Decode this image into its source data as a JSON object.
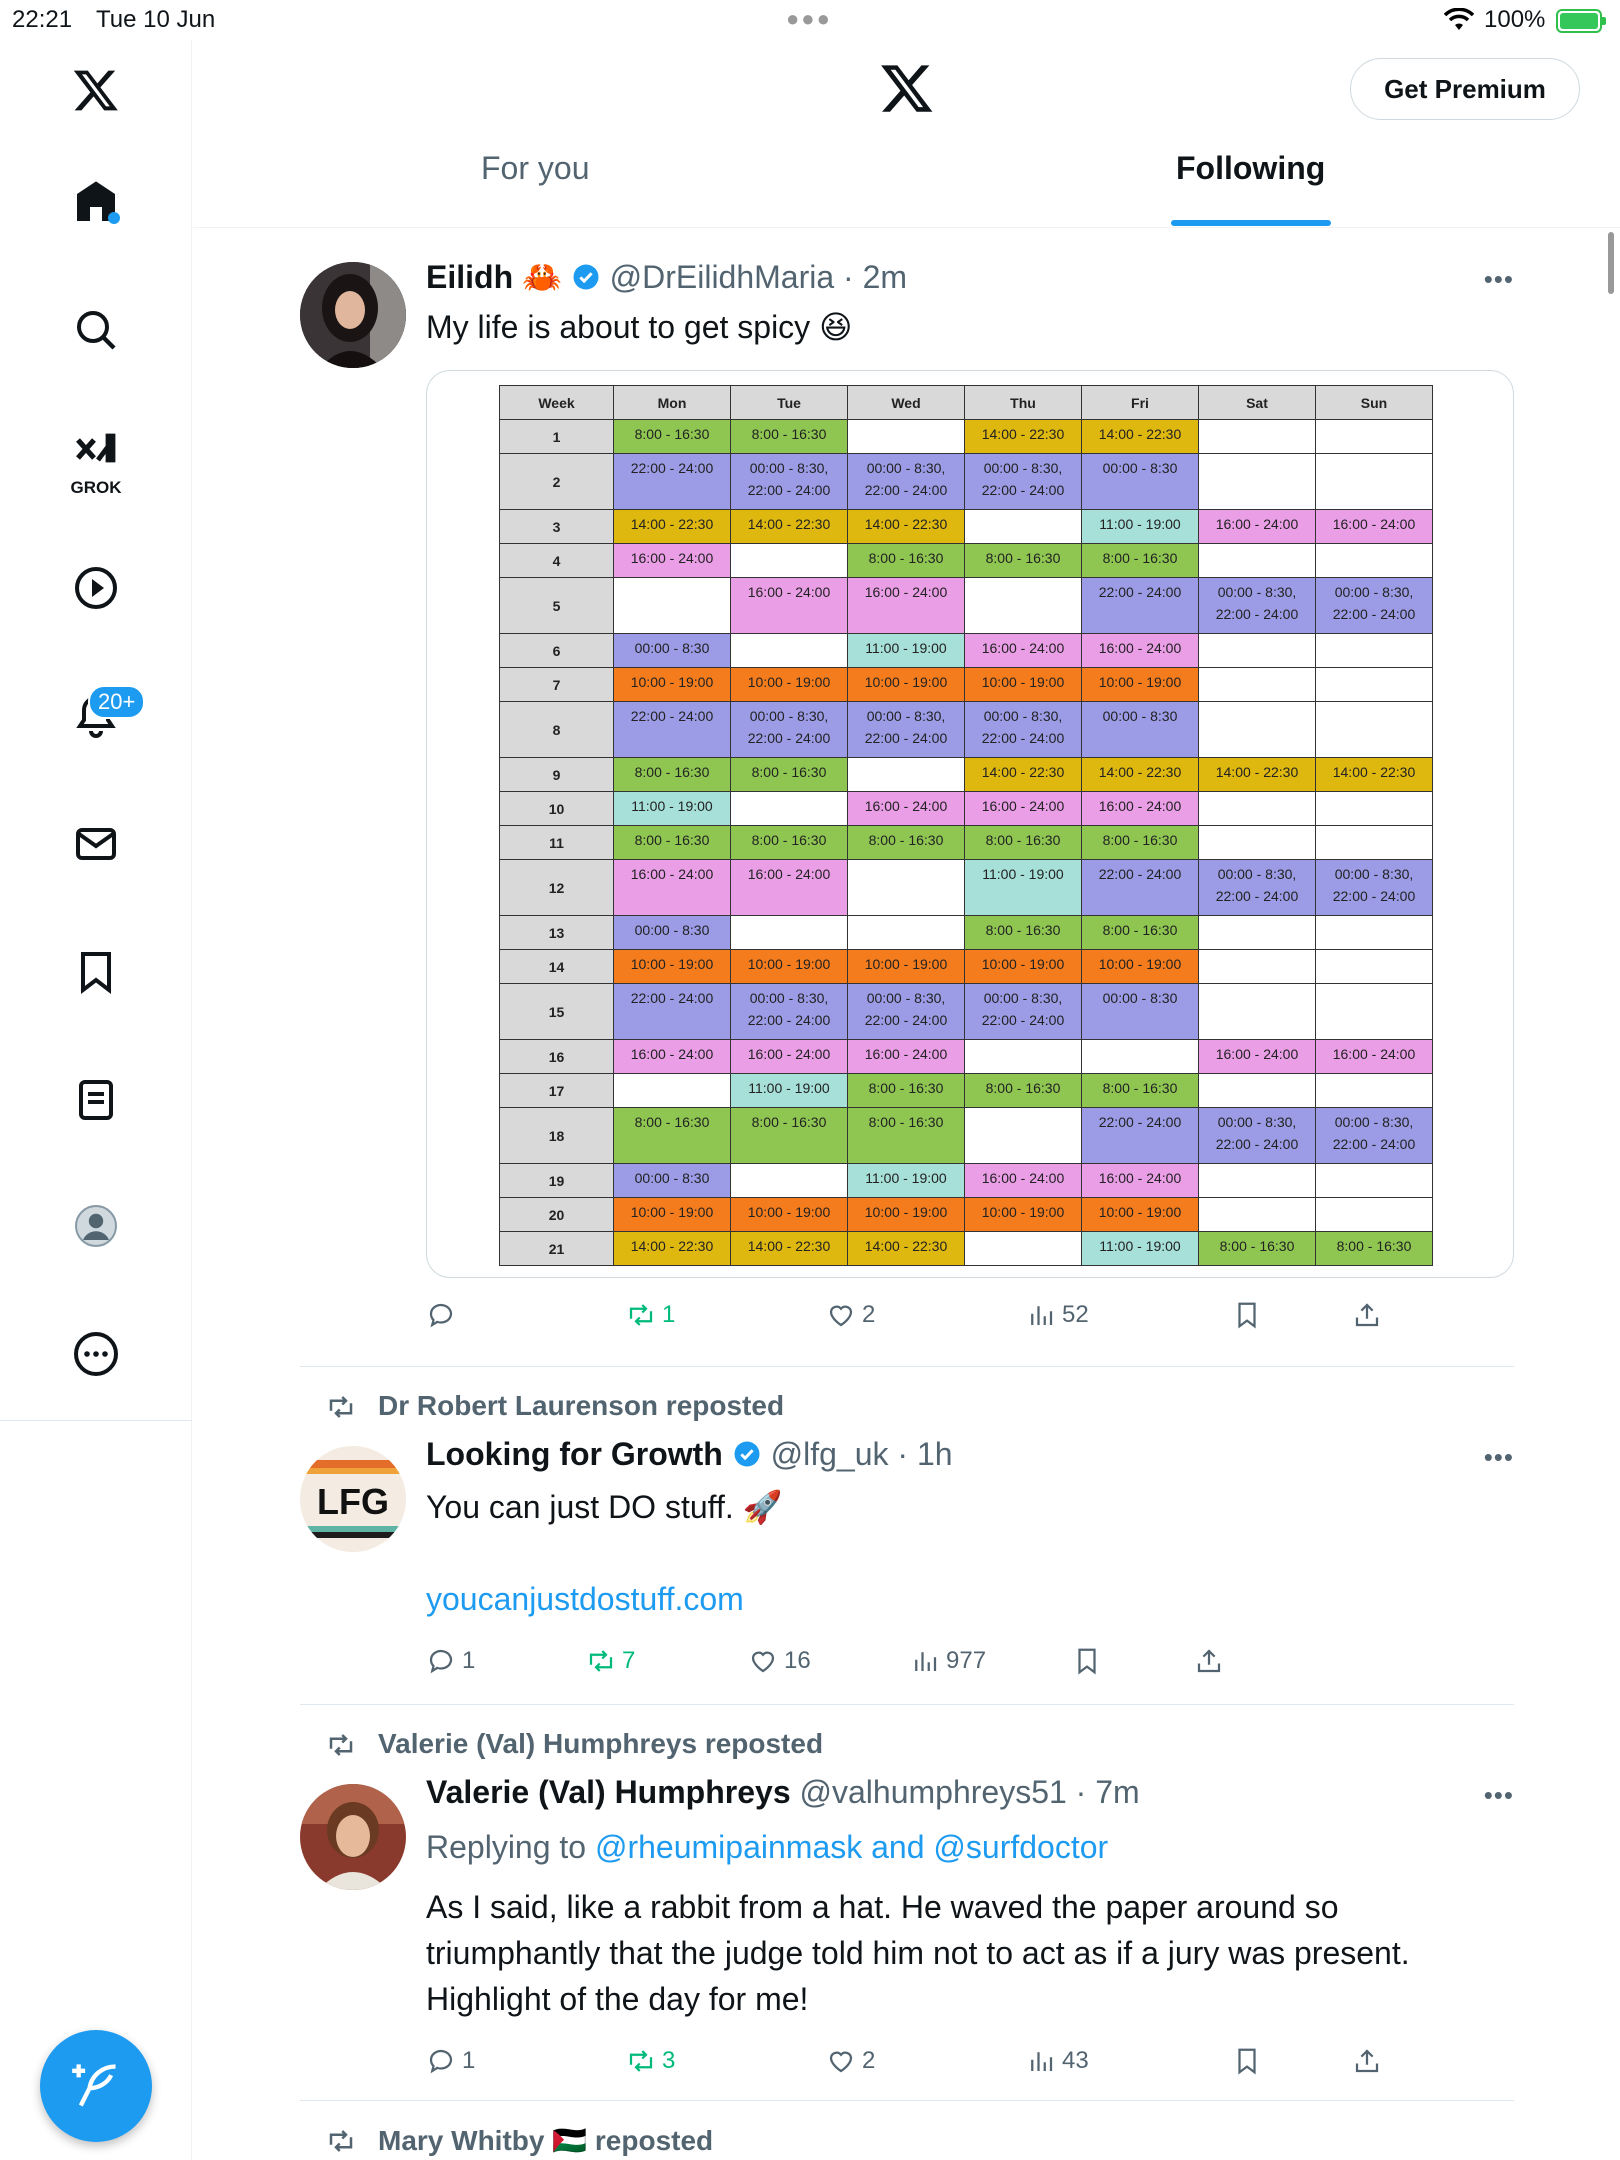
{
  "status": {
    "time": "22:21",
    "date": "Tue 10 Jun",
    "battery": "100%"
  },
  "sidebar": {
    "grok_label": "GROK",
    "notif_badge": "20+",
    "items": [
      "home-icon",
      "search-icon",
      "grok-icon",
      "video-icon",
      "notifications-icon",
      "messages-icon",
      "bookmarks-icon",
      "lists-icon",
      "profile-icon",
      "more-icon"
    ]
  },
  "header": {
    "premium_label": "Get Premium",
    "tabs": [
      {
        "label": "For you"
      },
      {
        "label": "Following"
      }
    ]
  },
  "tweets": [
    {
      "name": "Eilidh",
      "emoji": "🦀",
      "handle": "@DrEilidhMaria",
      "time": "2m",
      "text": "My life is about to get spicy 😆",
      "actions": {
        "replies": "",
        "reposts": "1",
        "likes": "2",
        "views": "52"
      },
      "schedule": {
        "headers": [
          "Week",
          "Mon",
          "Tue",
          "Wed",
          "Thu",
          "Fri",
          "Sat",
          "Sun"
        ],
        "rows": [
          {
            "week": "1",
            "tall": false,
            "cells": [
              [
                "8:00 - 16:30",
                "green"
              ],
              [
                "8:00 - 16:30",
                "green"
              ],
              [
                "",
                "white"
              ],
              [
                "14:00 - 22:30",
                "yellow"
              ],
              [
                "14:00 - 22:30",
                "yellow"
              ],
              [
                "",
                "white"
              ],
              [
                "",
                "white"
              ]
            ]
          },
          {
            "week": "2",
            "tall": true,
            "cells": [
              [
                "22:00 - 24:00",
                "blue"
              ],
              [
                "00:00 - 8:30, 22:00 - 24:00",
                "blue"
              ],
              [
                "00:00 - 8:30, 22:00 - 24:00",
                "blue"
              ],
              [
                "00:00 - 8:30, 22:00 - 24:00",
                "blue"
              ],
              [
                "00:00 - 8:30",
                "blue"
              ],
              [
                "",
                "white"
              ],
              [
                "",
                "white"
              ]
            ]
          },
          {
            "week": "3",
            "tall": false,
            "cells": [
              [
                "14:00 - 22:30",
                "yellow"
              ],
              [
                "14:00 - 22:30",
                "yellow"
              ],
              [
                "14:00 - 22:30",
                "yellow"
              ],
              [
                "",
                "white"
              ],
              [
                "11:00 - 19:00",
                "cyan"
              ],
              [
                "16:00 - 24:00",
                "pink"
              ],
              [
                "16:00 - 24:00",
                "pink"
              ]
            ]
          },
          {
            "week": "4",
            "tall": false,
            "cells": [
              [
                "16:00 - 24:00",
                "pink"
              ],
              [
                "",
                "white"
              ],
              [
                "8:00 - 16:30",
                "green"
              ],
              [
                "8:00 - 16:30",
                "green"
              ],
              [
                "8:00 - 16:30",
                "green"
              ],
              [
                "",
                "white"
              ],
              [
                "",
                "white"
              ]
            ]
          },
          {
            "week": "5",
            "tall": true,
            "cells": [
              [
                "",
                "white"
              ],
              [
                "16:00 - 24:00",
                "pink"
              ],
              [
                "16:00 - 24:00",
                "pink"
              ],
              [
                "",
                "white"
              ],
              [
                "22:00 - 24:00",
                "blue"
              ],
              [
                "00:00 - 8:30, 22:00 - 24:00",
                "blue"
              ],
              [
                "00:00 - 8:30, 22:00 - 24:00",
                "blue"
              ]
            ]
          },
          {
            "week": "6",
            "tall": false,
            "cells": [
              [
                "00:00 - 8:30",
                "blue"
              ],
              [
                "",
                "white"
              ],
              [
                "11:00 - 19:00",
                "cyan"
              ],
              [
                "16:00 - 24:00",
                "pink"
              ],
              [
                "16:00 - 24:00",
                "pink"
              ],
              [
                "",
                "white"
              ],
              [
                "",
                "white"
              ]
            ]
          },
          {
            "week": "7",
            "tall": false,
            "cells": [
              [
                "10:00 - 19:00",
                "orange"
              ],
              [
                "10:00 - 19:00",
                "orange"
              ],
              [
                "10:00 - 19:00",
                "orange"
              ],
              [
                "10:00 - 19:00",
                "orange"
              ],
              [
                "10:00 - 19:00",
                "orange"
              ],
              [
                "",
                "white"
              ],
              [
                "",
                "white"
              ]
            ]
          },
          {
            "week": "8",
            "tall": true,
            "cells": [
              [
                "22:00 - 24:00",
                "blue"
              ],
              [
                "00:00 - 8:30, 22:00 - 24:00",
                "blue"
              ],
              [
                "00:00 - 8:30, 22:00 - 24:00",
                "blue"
              ],
              [
                "00:00 - 8:30, 22:00 - 24:00",
                "blue"
              ],
              [
                "00:00 - 8:30",
                "blue"
              ],
              [
                "",
                "white"
              ],
              [
                "",
                "white"
              ]
            ]
          },
          {
            "week": "9",
            "tall": false,
            "cells": [
              [
                "8:00 - 16:30",
                "green"
              ],
              [
                "8:00 - 16:30",
                "green"
              ],
              [
                "",
                "white"
              ],
              [
                "14:00 - 22:30",
                "yellow"
              ],
              [
                "14:00 - 22:30",
                "yellow"
              ],
              [
                "14:00 - 22:30",
                "yellow"
              ],
              [
                "14:00 - 22:30",
                "yellow"
              ]
            ]
          },
          {
            "week": "10",
            "tall": false,
            "cells": [
              [
                "11:00 - 19:00",
                "cyan"
              ],
              [
                "",
                "white"
              ],
              [
                "16:00 - 24:00",
                "pink"
              ],
              [
                "16:00 - 24:00",
                "pink"
              ],
              [
                "16:00 - 24:00",
                "pink"
              ],
              [
                "",
                "white"
              ],
              [
                "",
                "white"
              ]
            ]
          },
          {
            "week": "11",
            "tall": false,
            "cells": [
              [
                "8:00 - 16:30",
                "green"
              ],
              [
                "8:00 - 16:30",
                "green"
              ],
              [
                "8:00 - 16:30",
                "green"
              ],
              [
                "8:00 - 16:30",
                "green"
              ],
              [
                "8:00 - 16:30",
                "green"
              ],
              [
                "",
                "white"
              ],
              [
                "",
                "white"
              ]
            ]
          },
          {
            "week": "12",
            "tall": true,
            "cells": [
              [
                "16:00 - 24:00",
                "pink"
              ],
              [
                "16:00 - 24:00",
                "pink"
              ],
              [
                "",
                "white"
              ],
              [
                "11:00 - 19:00",
                "cyan"
              ],
              [
                "22:00 - 24:00",
                "blue"
              ],
              [
                "00:00 - 8:30, 22:00 - 24:00",
                "blue"
              ],
              [
                "00:00 - 8:30, 22:00 - 24:00",
                "blue"
              ]
            ]
          },
          {
            "week": "13",
            "tall": false,
            "cells": [
              [
                "00:00 - 8:30",
                "blue"
              ],
              [
                "",
                "white"
              ],
              [
                "",
                "white"
              ],
              [
                "8:00 - 16:30",
                "green"
              ],
              [
                "8:00 - 16:30",
                "green"
              ],
              [
                "",
                "white"
              ],
              [
                "",
                "white"
              ]
            ]
          },
          {
            "week": "14",
            "tall": false,
            "cells": [
              [
                "10:00 - 19:00",
                "orange"
              ],
              [
                "10:00 - 19:00",
                "orange"
              ],
              [
                "10:00 - 19:00",
                "orange"
              ],
              [
                "10:00 - 19:00",
                "orange"
              ],
              [
                "10:00 - 19:00",
                "orange"
              ],
              [
                "",
                "white"
              ],
              [
                "",
                "white"
              ]
            ]
          },
          {
            "week": "15",
            "tall": true,
            "cells": [
              [
                "22:00 - 24:00",
                "blue"
              ],
              [
                "00:00 - 8:30, 22:00 - 24:00",
                "blue"
              ],
              [
                "00:00 - 8:30, 22:00 - 24:00",
                "blue"
              ],
              [
                "00:00 - 8:30, 22:00 - 24:00",
                "blue"
              ],
              [
                "00:00 - 8:30",
                "blue"
              ],
              [
                "",
                "white"
              ],
              [
                "",
                "white"
              ]
            ]
          },
          {
            "week": "16",
            "tall": false,
            "cells": [
              [
                "16:00 - 24:00",
                "pink"
              ],
              [
                "16:00 - 24:00",
                "pink"
              ],
              [
                "16:00 - 24:00",
                "pink"
              ],
              [
                "",
                "white"
              ],
              [
                "",
                "white"
              ],
              [
                "16:00 - 24:00",
                "pink"
              ],
              [
                "16:00 - 24:00",
                "pink"
              ]
            ]
          },
          {
            "week": "17",
            "tall": false,
            "cells": [
              [
                "",
                "white"
              ],
              [
                "11:00 - 19:00",
                "cyan"
              ],
              [
                "8:00 - 16:30",
                "green"
              ],
              [
                "8:00 - 16:30",
                "green"
              ],
              [
                "8:00 - 16:30",
                "green"
              ],
              [
                "",
                "white"
              ],
              [
                "",
                "white"
              ]
            ]
          },
          {
            "week": "18",
            "tall": true,
            "cells": [
              [
                "8:00 - 16:30",
                "green"
              ],
              [
                "8:00 - 16:30",
                "green"
              ],
              [
                "8:00 - 16:30",
                "green"
              ],
              [
                "",
                "white"
              ],
              [
                "22:00 - 24:00",
                "blue"
              ],
              [
                "00:00 - 8:30, 22:00 - 24:00",
                "blue"
              ],
              [
                "00:00 - 8:30, 22:00 - 24:00",
                "blue"
              ]
            ]
          },
          {
            "week": "19",
            "tall": false,
            "cells": [
              [
                "00:00 - 8:30",
                "blue"
              ],
              [
                "",
                "white"
              ],
              [
                "11:00 - 19:00",
                "cyan"
              ],
              [
                "16:00 - 24:00",
                "pink"
              ],
              [
                "16:00 - 24:00",
                "pink"
              ],
              [
                "",
                "white"
              ],
              [
                "",
                "white"
              ]
            ]
          },
          {
            "week": "20",
            "tall": false,
            "cells": [
              [
                "10:00 - 19:00",
                "orange"
              ],
              [
                "10:00 - 19:00",
                "orange"
              ],
              [
                "10:00 - 19:00",
                "orange"
              ],
              [
                "10:00 - 19:00",
                "orange"
              ],
              [
                "10:00 - 19:00",
                "orange"
              ],
              [
                "",
                "white"
              ],
              [
                "",
                "white"
              ]
            ]
          },
          {
            "week": "21",
            "tall": false,
            "cells": [
              [
                "14:00 - 22:30",
                "yellow"
              ],
              [
                "14:00 - 22:30",
                "yellow"
              ],
              [
                "14:00 - 22:30",
                "yellow"
              ],
              [
                "",
                "white"
              ],
              [
                "11:00 - 19:00",
                "cyan"
              ],
              [
                "8:00 - 16:30",
                "green"
              ],
              [
                "8:00 - 16:30",
                "green"
              ]
            ]
          }
        ]
      }
    },
    {
      "reposted_by": "Dr Robert Laurenson reposted",
      "name": "Looking for Growth",
      "handle": "@lfg_uk",
      "time": "1h",
      "avatar_text": "LFG",
      "text": "You can just DO stuff. 🚀",
      "link": "youcanjustdostuff.com",
      "actions": {
        "replies": "1",
        "reposts": "7",
        "likes": "16",
        "views": "977"
      }
    },
    {
      "reposted_by": "Valerie (Val) Humphreys reposted",
      "name": "Valerie (Val) Humphreys",
      "handle": "@valhumphreys51",
      "time": "7m",
      "replying_prefix": "Replying to",
      "replying_to": "@rheumipainmask and @surfdoctor",
      "text": "As I said, like a rabbit from a hat. He waved the paper around so triumphantly that the judge told him not to act as if a jury was present. Highlight of the day for me!",
      "actions": {
        "replies": "1",
        "reposts": "3",
        "likes": "2",
        "views": "43"
      }
    },
    {
      "reposted_by_name": "Mary Whitby",
      "reposted_flag": "🇵🇸",
      "reposted_suffix": "reposted"
    }
  ],
  "colors": {
    "accent": "#1d9bf0",
    "repost_green": "#00ba7c",
    "muted": "#536471",
    "schedule": {
      "green": "#8fc652",
      "yellow": "#dfb80f",
      "blue": "#9c9ce6",
      "pink": "#ea9ee6",
      "cyan": "#a6e0d8",
      "orange": "#f57c1c",
      "white": "#ffffff"
    }
  }
}
